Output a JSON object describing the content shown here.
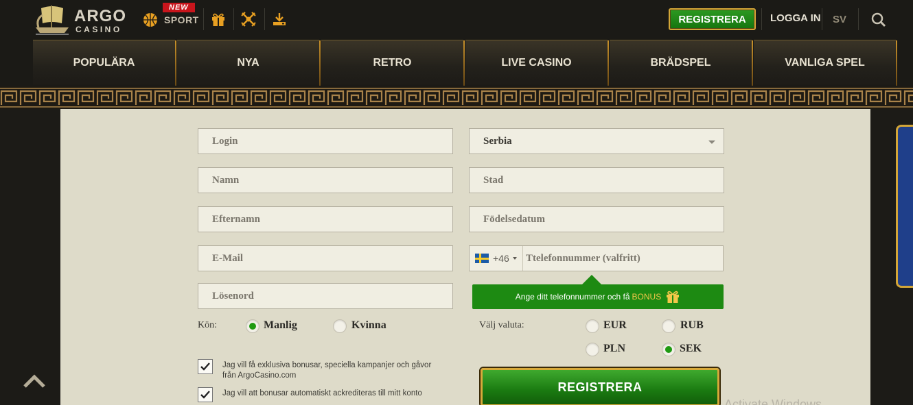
{
  "header": {
    "logo_main": "ARGO",
    "logo_sub": "CASINO",
    "sport_badge": "NEW",
    "sport_label": "SPORT",
    "register_label": "REGISTRERA",
    "login_label": "LOGGA IN",
    "language": "SV"
  },
  "nav": [
    {
      "label": "POPULÄRA"
    },
    {
      "label": "NYA"
    },
    {
      "label": "RETRO"
    },
    {
      "label": "LIVE CASINO"
    },
    {
      "label": "BRÄDSPEL"
    },
    {
      "label": "VANLIGA SPEL"
    }
  ],
  "form": {
    "login_placeholder": "Login",
    "name_placeholder": "Namn",
    "surname_placeholder": "Efternamn",
    "email_placeholder": "E-Mail",
    "password_placeholder": "Lösenord",
    "country_value": "Serbia",
    "city_placeholder": "Stad",
    "birthdate_placeholder": "Födelsedatum",
    "phone_code": "+46",
    "phone_placeholder": "Ttelefonnummer (valfritt)",
    "bonus_text": "Ange ditt telefonnummer och få",
    "bonus_highlight": "BONUS",
    "gender_label": "Kön:",
    "gender_options": [
      {
        "label": "Manlig",
        "selected": true
      },
      {
        "label": "Kvinna",
        "selected": false
      }
    ],
    "currency_label": "Välj valuta:",
    "currencies": [
      {
        "label": "EUR",
        "selected": false
      },
      {
        "label": "RUB",
        "selected": false
      },
      {
        "label": "PLN",
        "selected": false
      },
      {
        "label": "SEK",
        "selected": true
      }
    ],
    "checkbox_1": "Jag vill få exklusiva bonusar, speciella kampanjer och gåvor från ArgoCasino.com",
    "checkbox_2": "Jag vill att bonusar automatiskt ackrediteras till mitt konto",
    "submit_label": "REGISTRERA"
  },
  "overlay": {
    "watermark": "Activate Windows"
  },
  "colors": {
    "accent_green": "#1d8a12",
    "gold": "#d3a638",
    "panel": "#dedbc9",
    "header_bg": "#1b1a16"
  }
}
